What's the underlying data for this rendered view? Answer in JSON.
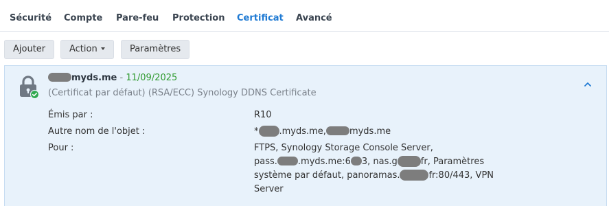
{
  "tabs": [
    {
      "label": "Sécurité",
      "active": false
    },
    {
      "label": "Compte",
      "active": false
    },
    {
      "label": "Pare-feu",
      "active": false
    },
    {
      "label": "Protection",
      "active": false
    },
    {
      "label": "Certificat",
      "active": true
    },
    {
      "label": "Avancé",
      "active": false
    }
  ],
  "toolbar": {
    "add_label": "Ajouter",
    "action_label": "Action",
    "settings_label": "Paramètres"
  },
  "certificate": {
    "domain_suffix": "myds.me",
    "separator": "-",
    "expiry_date": "11/09/2025",
    "description": "(Certificat par défaut) (RSA/ECC) Synology DDNS Certificate",
    "icon": "lock-check-icon",
    "details": {
      "issued_by_label": "Émis par :",
      "issued_by_value": "R10",
      "alt_name_label": "Autre nom de l'objet :",
      "alt_name_prefix": "*",
      "alt_name_mid": ".myds.me,",
      "alt_name_end": "myds.me",
      "for_label": "Pour :",
      "for_line1": "FTPS, Synology Storage Console Server,",
      "for_line2_a": "pass.",
      "for_line2_b": ".myds.me:6",
      "for_line2_c": "3, nas.g",
      "for_line2_d": "fr, Paramètres",
      "for_line3_a": "système par défaut, panoramas.",
      "for_line3_b": "fr:80/443, VPN",
      "for_line4": "Server"
    }
  },
  "colors": {
    "accent": "#1f7ad3",
    "card_bg": "#e8f2fb",
    "date_green": "#2f9a2f",
    "button_bg": "#e5e9ee"
  }
}
